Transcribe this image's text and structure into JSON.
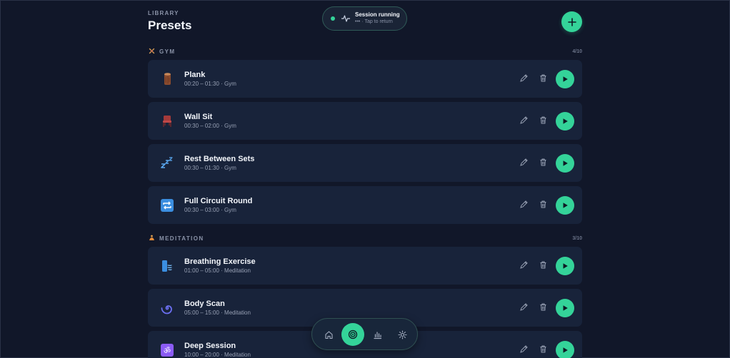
{
  "header": {
    "eyebrow": "LIBRARY",
    "title": "Presets"
  },
  "session": {
    "title": "Session running",
    "subtitle": "••• · Tap to return",
    "status_color": "#34d399"
  },
  "sections": [
    {
      "label": "GYM",
      "count": "4/10",
      "icon": "dumbbell-icon",
      "items": [
        {
          "title": "Plank",
          "meta": "00:20 – 01:30 · Gym",
          "icon": "log-icon"
        },
        {
          "title": "Wall Sit",
          "meta": "00:30 – 02:00 · Gym",
          "icon": "chair-icon"
        },
        {
          "title": "Rest Between Sets",
          "meta": "00:30 – 01:30 · Gym",
          "icon": "zzz-icon"
        },
        {
          "title": "Full Circuit Round",
          "meta": "00:30 – 03:00 · Gym",
          "icon": "repeat-icon"
        }
      ]
    },
    {
      "label": "MEDITATION",
      "count": "3/10",
      "icon": "lotus-icon",
      "items": [
        {
          "title": "Breathing Exercise",
          "meta": "01:00 – 05:00 · Meditation",
          "icon": "breath-icon"
        },
        {
          "title": "Body Scan",
          "meta": "05:00 – 15:00 · Meditation",
          "icon": "spiral-icon"
        },
        {
          "title": "Deep Session",
          "meta": "10:00 – 20:00 · Meditation",
          "icon": "om-icon"
        }
      ]
    }
  ],
  "nav": [
    {
      "name": "home-icon",
      "active": false
    },
    {
      "name": "presets-icon",
      "active": true
    },
    {
      "name": "stats-icon",
      "active": false
    },
    {
      "name": "settings-icon",
      "active": false
    }
  ],
  "colors": {
    "accent": "#34d399",
    "background": "#111729",
    "card": "#18233a"
  }
}
